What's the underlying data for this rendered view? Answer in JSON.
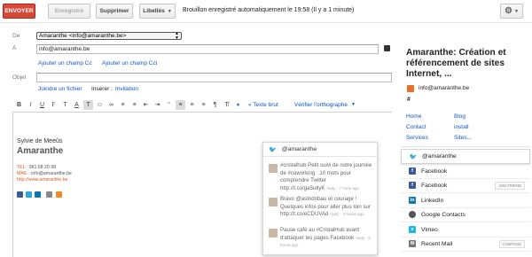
{
  "toolbar": {
    "send_label": "ENVOYER",
    "saved_label": "Enregistré",
    "delete_label": "Supprimer",
    "labels_label": "Libellés",
    "status": "Brouillon enregistré automatiquement le 19:58 (Il y a 1 minute)"
  },
  "compose": {
    "from_label": "De",
    "from_value": "Amaranthe <info@amaranthe.be>",
    "to_label": "À",
    "to_value": "info@amaranthe.be",
    "add_cc": "Ajouter un champ Cc",
    "add_bcc": "Ajouter un champ Cci",
    "subject_label": "Objet",
    "subject_value": "",
    "attach": "Joindre un fichier",
    "insert_label": "Insérer :",
    "invitation": "Invitation",
    "plain_text": "« Texte brut",
    "spellcheck": "Vérifier l'orthographe"
  },
  "signature": {
    "name": "Sylvie de Meeûs",
    "company": "Amaranthe",
    "tel_key": "TEL :",
    "tel": "081 58 20 98",
    "mail_key": "MAIL :",
    "mail": "info@amaranthe.be",
    "web": "http://www.amaranthe.be"
  },
  "twitter_popup": {
    "handle": "@amaranthe",
    "tweets": [
      {
        "text": "#cristalhub Petit suivi de notre journée de #coworking : 10 mots pour comprendre Twitter http://t.co/ga5utlyK",
        "meta": "reply · 7 mins ago"
      },
      {
        "text": "Bravo @astridribau et courage ! Quelques infos pour aller plus loin sur http://t.co/eCDUVAd",
        "meta": "reply · 4 hours ago"
      },
      {
        "text": "Pause café au #CristalHub avant d'attaquer les pages Facebook",
        "meta": "reply · 6 hours ago"
      }
    ]
  },
  "sidebar": {
    "title": "Amaranthe: Création et référencement de sites Internet, ...",
    "email": "info@amaranthe.be",
    "hash": "#",
    "links_left": [
      "Home",
      "Contact",
      "Services"
    ],
    "links_right": [
      "Blog",
      "install",
      "Sites..."
    ],
    "items": [
      {
        "label": "@amaranthe",
        "icon": "twitter-icon",
        "tag": ""
      },
      {
        "label": "Facebook",
        "icon": "facebook-icon",
        "tag": ""
      },
      {
        "label": "Facebook",
        "icon": "facebook-icon",
        "tag": "ADD FRIEND"
      },
      {
        "label": "LinkedIn",
        "icon": "linkedin-icon",
        "tag": ""
      },
      {
        "label": "Google Contacts",
        "icon": "google-contacts-icon",
        "tag": ""
      },
      {
        "label": "Vimeo",
        "icon": "vimeo-icon",
        "tag": ""
      },
      {
        "label": "Recent Mail",
        "icon": "mail-icon",
        "tag": "COMPOSE"
      }
    ]
  },
  "colors": {
    "send": "#d14836",
    "link": "#1155cc",
    "twitter": "#2aa9e0",
    "facebook": "#3b5998",
    "linkedin": "#0e76a8",
    "signature_accent": "#e25a1c"
  }
}
